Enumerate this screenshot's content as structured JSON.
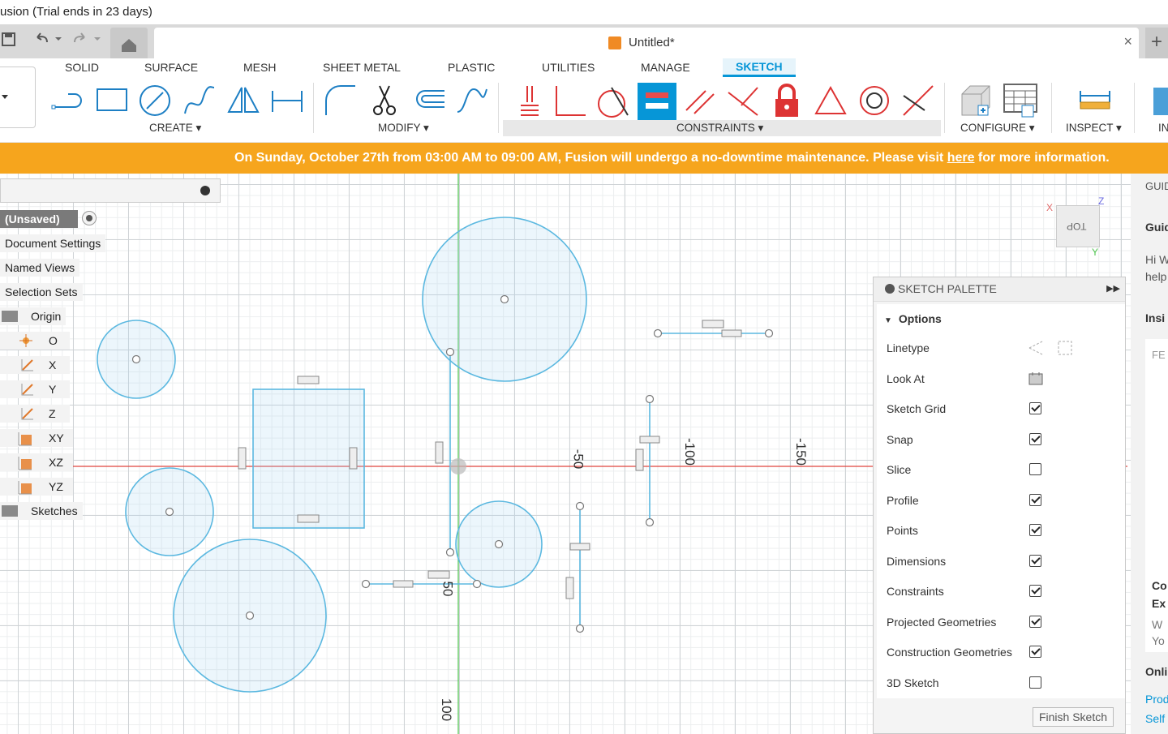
{
  "window": {
    "title": "usion (Trial ends in 23 days)"
  },
  "tabs": {
    "document_title": "Untitled*",
    "close_icon": "×",
    "new_tab_icon": "+"
  },
  "ribbon": {
    "tabs": [
      "SOLID",
      "SURFACE",
      "MESH",
      "SHEET METAL",
      "PLASTIC",
      "UTILITIES",
      "MANAGE",
      "SKETCH"
    ],
    "active_tab": "SKETCH",
    "groups": {
      "create": "CREATE ▾",
      "modify": "MODIFY ▾",
      "constraints": "CONSTRAINTS ▾",
      "configure": "CONFIGURE ▾",
      "inspect": "INSPECT ▾",
      "insert": "IN"
    }
  },
  "banner": {
    "text_before": "On Sunday, October 27th from 03:00 AM to 09:00 AM, Fusion will undergo a no-downtime maintenance. Please visit ",
    "link": "here",
    "text_after": " for more information.",
    "color": "#f6a51d"
  },
  "browser": {
    "root": "(Unsaved)",
    "nodes": [
      "Document Settings",
      "Named Views",
      "Selection Sets",
      "Origin",
      "O",
      "X",
      "Y",
      "Z",
      "XY",
      "XZ",
      "YZ",
      "Sketches"
    ]
  },
  "canvas": {
    "axis_labels": [
      "-50",
      "-100",
      "-150",
      "50",
      "100"
    ],
    "colors": {
      "x_axis": "#e0443f",
      "y_axis": "#4cc34c",
      "sketch": "#5bb8e0"
    }
  },
  "viewcube": {
    "face": "TOP",
    "x": "X",
    "y": "Y",
    "z": "Z"
  },
  "palette": {
    "title": "SKETCH PALETTE",
    "section": "Options",
    "rows": [
      {
        "label": "Linetype",
        "kind": "icons"
      },
      {
        "label": "Look At",
        "kind": "icon"
      },
      {
        "label": "Sketch Grid",
        "checked": true
      },
      {
        "label": "Snap",
        "checked": true
      },
      {
        "label": "Slice",
        "checked": false
      },
      {
        "label": "Profile",
        "checked": true
      },
      {
        "label": "Points",
        "checked": true
      },
      {
        "label": "Dimensions",
        "checked": true
      },
      {
        "label": "Constraints",
        "checked": true
      },
      {
        "label": "Projected Geometries",
        "checked": true
      },
      {
        "label": "Construction Geometries",
        "checked": true
      },
      {
        "label": "3D Sketch",
        "checked": false
      }
    ],
    "finish_button": "Finish Sketch"
  },
  "guide": {
    "tab": "GUID",
    "heading": "Guid",
    "lines": [
      "Hi W",
      "help"
    ],
    "section": "Insi",
    "fe": "FE",
    "co": "Co",
    "ex": "Ex",
    "w": "W",
    "yo": "Yo",
    "online": "Onli",
    "prod": "Prod",
    "self": "Self"
  }
}
